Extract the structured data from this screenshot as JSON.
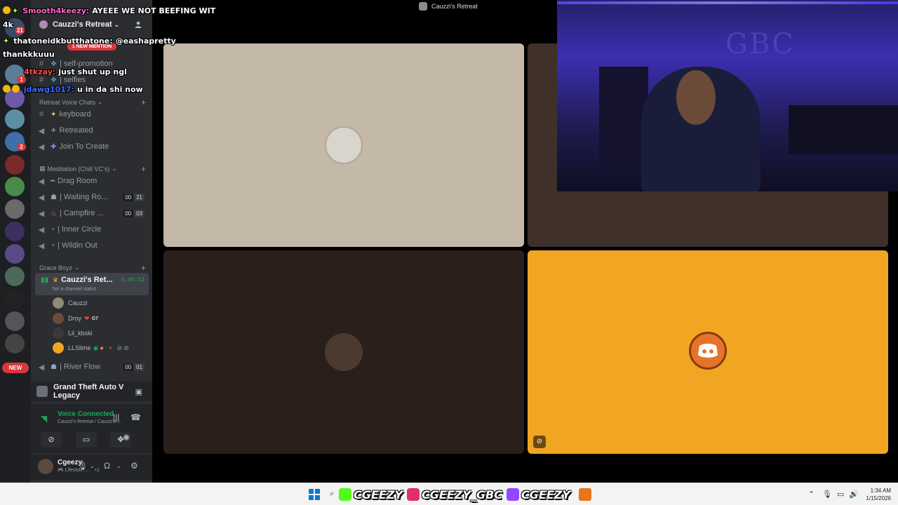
{
  "server": {
    "name": "Cauzzi's Retreat",
    "mention_pill": "1 NEW MENTION",
    "rail_badges": [
      "21",
      "1",
      "2"
    ],
    "new_pill": "NEW"
  },
  "channels_top": [
    {
      "name": "| self-promotion"
    },
    {
      "name": "| selfies"
    }
  ],
  "categories": {
    "voice": "Retreat Voice Chats",
    "meditation": "Meditation (Chill VC's)",
    "grace": "Grace Boyz"
  },
  "voice_channels": [
    {
      "name": "keyboard"
    },
    {
      "name": "Retreated"
    },
    {
      "name": "Join To Create"
    }
  ],
  "meditation_channels": [
    {
      "name": "Drag Room"
    },
    {
      "name": "| Waiting Ro...",
      "count_a": "00",
      "count_b": "21"
    },
    {
      "name": "| Campfire ...",
      "count_a": "00",
      "count_b": "03"
    },
    {
      "name": "| Inner Circle"
    },
    {
      "name": "| Wildin Out"
    }
  ],
  "active_channel": {
    "name": "Cauzzi's Ret...",
    "timer": "6:06:12",
    "status": "Set a channel status"
  },
  "members": [
    {
      "name": "Cauzzi"
    },
    {
      "name": "Droy",
      "tag": "G7"
    },
    {
      "name": "Lil_kbski"
    },
    {
      "name": "LLSlime"
    }
  ],
  "river_flow": {
    "name": "| River Flow",
    "count_a": "00",
    "count_b": "01"
  },
  "game": {
    "name": "Grand Theft Auto V Legacy"
  },
  "voice": {
    "status": "Voice Connected",
    "location": "Cauzzi's Retreat / Cauzzi's ..."
  },
  "user": {
    "name": "Cgeezy",
    "status": "Lifestyle ...",
    "extra": "+1"
  },
  "call": {
    "title": "Cauzzi's Retreat"
  },
  "chat": [
    {
      "user": "Smooth4keezy:",
      "message": "AYEEE WE NOT BEEFING WIT",
      "color": "#ff66cc"
    },
    {
      "user": "thatoneidkbutthatone:",
      "message": "@eashapretty",
      "color": "#ffffff"
    },
    {
      "user": "",
      "message": "thankkkuuu",
      "color": "#ffffff"
    },
    {
      "user": "4tkzay:",
      "message": "just shut up ngl",
      "color": "#ff4d4d"
    },
    {
      "user": "jdawg1017:",
      "message": "u in da shi now",
      "color": "#3d6bff"
    }
  ],
  "rail_label": "4k",
  "banner": {
    "kick": "CGEEZY",
    "instagram": "CGEEZY_GBC",
    "twitch": "CGEEZY"
  },
  "webcam": {
    "wall_text": "GBC"
  },
  "clock": {
    "time": "1:34 AM",
    "date": "1/15/2026"
  },
  "colors": {
    "accent_green": "#23a55a",
    "tile_light": "#c4b8a8",
    "tile_dark": "#40302a",
    "tile_orange": "#f0a623",
    "mention_red": "#da373c"
  }
}
